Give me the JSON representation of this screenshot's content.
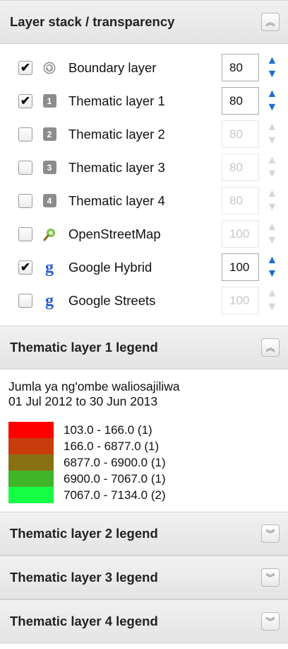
{
  "layer_stack": {
    "title": "Layer stack / transparency",
    "collapse_icon": "double-chevron-up-icon",
    "layers": [
      {
        "label": "Boundary layer",
        "checked": true,
        "icon": "globe-icon",
        "opacity": "80",
        "enabled": true
      },
      {
        "label": "Thematic layer 1",
        "checked": true,
        "icon_text": "1",
        "opacity": "80",
        "enabled": true
      },
      {
        "label": "Thematic layer 2",
        "checked": false,
        "icon_text": "2",
        "opacity": "80",
        "enabled": false
      },
      {
        "label": "Thematic layer 3",
        "checked": false,
        "icon_text": "3",
        "opacity": "80",
        "enabled": false
      },
      {
        "label": "Thematic layer 4",
        "checked": false,
        "icon_text": "4",
        "opacity": "80",
        "enabled": false
      },
      {
        "label": "OpenStreetMap",
        "checked": false,
        "icon": "map-pin-icon",
        "opacity": "100",
        "enabled": false
      },
      {
        "label": "Google Hybrid",
        "checked": true,
        "icon_text": "g",
        "opacity": "100",
        "enabled": true
      },
      {
        "label": "Google Streets",
        "checked": false,
        "icon_text": "g",
        "opacity": "100",
        "enabled": false
      }
    ]
  },
  "legend1": {
    "title": "Thematic layer 1 legend",
    "collapse_icon": "double-chevron-up-icon",
    "subtitle_line1": "Jumla ya ng'ombe waliosajiliwa",
    "subtitle_line2": "01 Jul 2012 to 30 Jun 2013",
    "items": [
      {
        "label": "103.0 - 166.0  (1)",
        "color": "#ff0000"
      },
      {
        "label": "166.0 - 6877.0  (1)",
        "color": "#c93c0c"
      },
      {
        "label": "6877.0 - 6900.0  (1)",
        "color": "#8a7014"
      },
      {
        "label": "6900.0 - 7067.0  (1)",
        "color": "#41b52a"
      },
      {
        "label": "7067.0 - 7134.0  (2)",
        "color": "#15ff45"
      }
    ]
  },
  "legend2": {
    "title": "Thematic layer 2 legend",
    "expand_icon": "double-chevron-down-icon"
  },
  "legend3": {
    "title": "Thematic layer 3 legend",
    "expand_icon": "double-chevron-down-icon"
  },
  "legend4": {
    "title": "Thematic layer 4 legend",
    "expand_icon": "double-chevron-down-icon"
  }
}
